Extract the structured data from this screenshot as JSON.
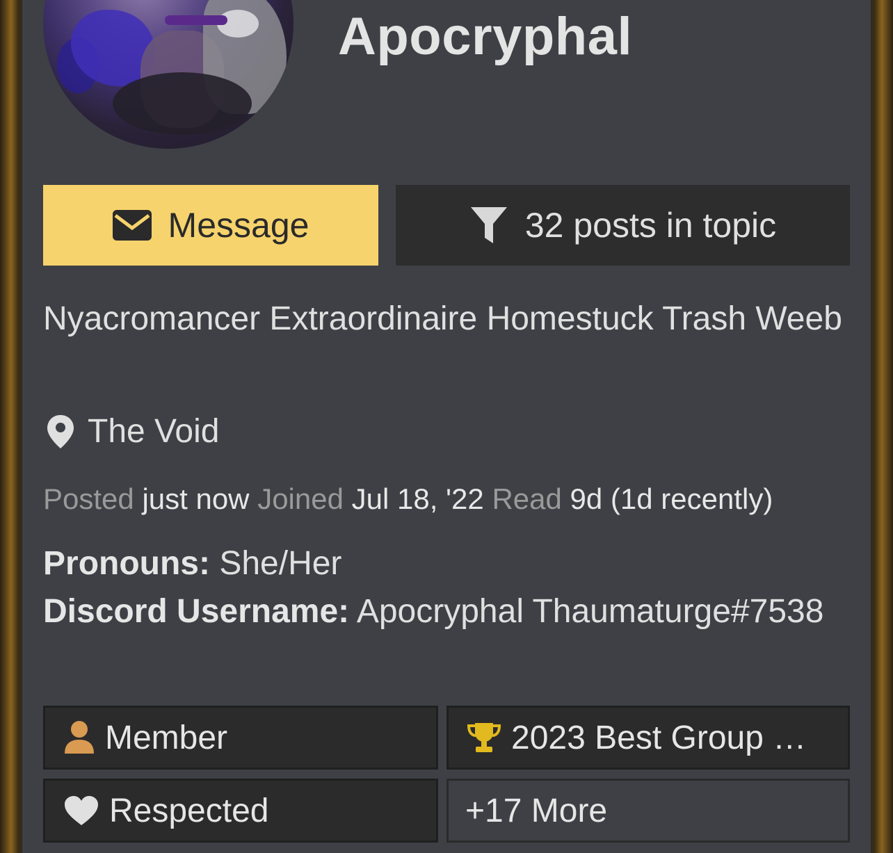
{
  "profile": {
    "username": "Apocryphal",
    "avatar_alt": "avatar"
  },
  "actions": {
    "message_label": "Message",
    "posts_label": "32 posts in topic",
    "message_icon": "envelope-icon",
    "posts_icon": "filter-icon"
  },
  "bio": "Nyacromancer Extraordinaire Homestuck Trash Weeb",
  "location": {
    "icon": "map-pin-icon",
    "text": "The Void"
  },
  "stats": {
    "posted_label": "Posted",
    "posted_value": "just now",
    "joined_label": "Joined",
    "joined_value": "Jul 18, '22",
    "read_label": "Read",
    "read_value": "9d (1d recently)"
  },
  "fields": {
    "pronouns_label": "Pronouns:",
    "pronouns_value": "She/Her",
    "discord_label": "Discord Username:",
    "discord_value": "Apocryphal Thaumaturge#7538"
  },
  "badges": {
    "member": {
      "label": "Member",
      "icon": "user-icon",
      "color": "#d99a52"
    },
    "award": {
      "label": "2023 Best Group …",
      "icon": "trophy-icon",
      "color": "#e2b91e"
    },
    "respected": {
      "label": "Respected",
      "icon": "heart-icon",
      "color": "#e0e0e0"
    },
    "more": {
      "label": "+17 More"
    }
  },
  "colors": {
    "card_bg": "#3e4045",
    "message_button_bg": "#f6d36d",
    "posts_button_bg": "#2d2d2d",
    "frame_accent": "#8a6420"
  }
}
